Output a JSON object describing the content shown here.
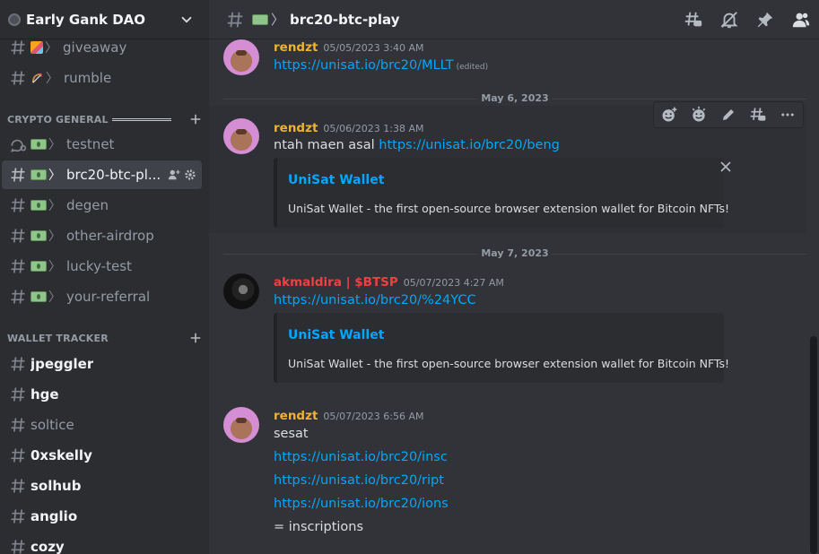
{
  "server": {
    "name": "Early Gank DAO"
  },
  "sidebar": {
    "top_channels": [
      {
        "label": "giveaway",
        "emoji": "party-popper-emoji"
      },
      {
        "label": "rumble",
        "emoji": "bow-and-arrow-emoji"
      }
    ],
    "categories": [
      {
        "label": "CRYPTO GENERAL",
        "channels": [
          {
            "label": "testnet",
            "kind": "forum"
          },
          {
            "label": "brc20-btc-pl...",
            "kind": "text",
            "active": true
          },
          {
            "label": "degen"
          },
          {
            "label": "other-airdrop"
          },
          {
            "label": "lucky-test"
          },
          {
            "label": "your-referral"
          }
        ]
      },
      {
        "label": "WALLET TRACKER",
        "channels": [
          {
            "label": "jpeggler",
            "unread": true
          },
          {
            "label": "hge",
            "unread": true
          },
          {
            "label": "soltice",
            "unread": false
          },
          {
            "label": "0xskelly",
            "unread": true
          },
          {
            "label": "solhub",
            "unread": true
          },
          {
            "label": "anglio",
            "unread": true
          },
          {
            "label": "cozy",
            "unread": true
          }
        ]
      }
    ]
  },
  "channel_header": {
    "title": "brc20-btc-play",
    "separator": "〉",
    "icons": [
      "threads-icon",
      "mute-icon",
      "pin-icon",
      "member-list-icon"
    ]
  },
  "messages": [
    {
      "author": "rendzt",
      "timestamp": "05/05/2023 3:40 AM",
      "lines": [
        "https://unisat.io/brc20/MLLT"
      ],
      "edited": "(edited)"
    },
    {
      "divider": "May 6, 2023"
    },
    {
      "author": "rendzt",
      "timestamp": "05/06/2023 1:38 AM",
      "text_prefix": "ntah maen asal ",
      "link": "https://unisat.io/brc20/beng",
      "embed": {
        "title": "UniSat Wallet",
        "description": "UniSat Wallet - the first open-source browser extension wallet for Bitcoin NFTs!"
      }
    },
    {
      "divider": "May 7, 2023"
    },
    {
      "author": "akmaldira | $BTSP",
      "timestamp": "05/07/2023 4:27 AM",
      "link": "https://unisat.io/brc20/%24YCC",
      "embed": {
        "title": "UniSat Wallet",
        "description": "UniSat Wallet - the first open-source browser extension wallet for Bitcoin NFTs!"
      }
    },
    {
      "author": "rendzt",
      "timestamp": "05/07/2023 6:56 AM",
      "lines": [
        "sesat",
        "https://unisat.io/brc20/insc",
        "https://unisat.io/brc20/ript",
        "https://unisat.io/brc20/ions",
        "= inscriptions"
      ]
    }
  ],
  "hover_toolbar": {
    "icons": [
      "add-reaction-icon",
      "super-reaction-icon",
      "edit-icon",
      "create-thread-icon",
      "more-icon"
    ]
  },
  "colors": {
    "sidebar_bg": "#2b2d31",
    "main_bg": "#313338",
    "link": "#00a8fc",
    "author_gold": "#f0b232",
    "author_red": "#f23f42"
  }
}
